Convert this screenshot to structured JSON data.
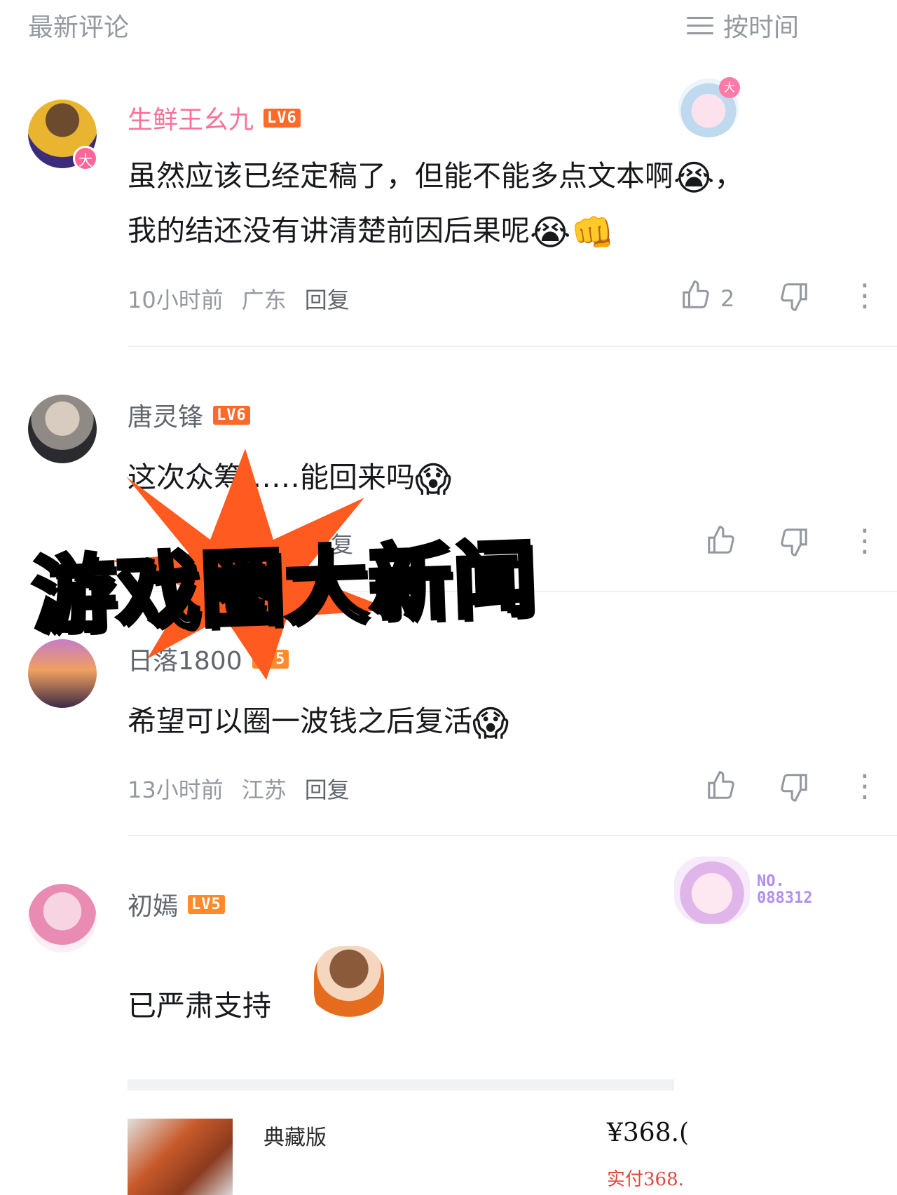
{
  "header": {
    "section_title": "最新评论",
    "sort_label": "按时间"
  },
  "overlay": {
    "banner_text": "游戏圈大新闻"
  },
  "comments": [
    {
      "username": "生鲜王幺九",
      "level": "LV6",
      "avatar_badge": "大",
      "content_line1": "虽然应该已经定稿了，但能不能多点文本啊",
      "content_line1_tail": "，",
      "content_line2": "我的结还没有讲清楚前因后果呢",
      "time": "10小时前",
      "location": "广东",
      "reply_label": "回复",
      "like_count": "2",
      "pendant_tag": "大"
    },
    {
      "username": "唐灵锋",
      "level": "LV6",
      "content": "这次众筹……能回来吗",
      "reply_label": "回复"
    },
    {
      "username": "日落1800",
      "level": "LV5",
      "content": "希望可以圈一波钱之后复活",
      "time": "13小时前",
      "location": "江苏",
      "reply_label": "回复"
    },
    {
      "username": "初嫣",
      "level": "LV5",
      "content": "已严肃支持",
      "pendant_no_label": "NO.",
      "pendant_no_value": "088312"
    }
  ],
  "product": {
    "name": "典藏版",
    "price": "¥368.(",
    "paid": "实付368."
  },
  "icons": {
    "sort": "menu-lines-icon",
    "like": "thumbs-up-icon",
    "dislike": "thumbs-down-icon",
    "more": "more-vertical-icon"
  },
  "colors": {
    "vip_name": "#fb7299",
    "level_badge": "#ff6a2b",
    "muted_text": "#9499a0",
    "burst": "#ff5a1f"
  }
}
